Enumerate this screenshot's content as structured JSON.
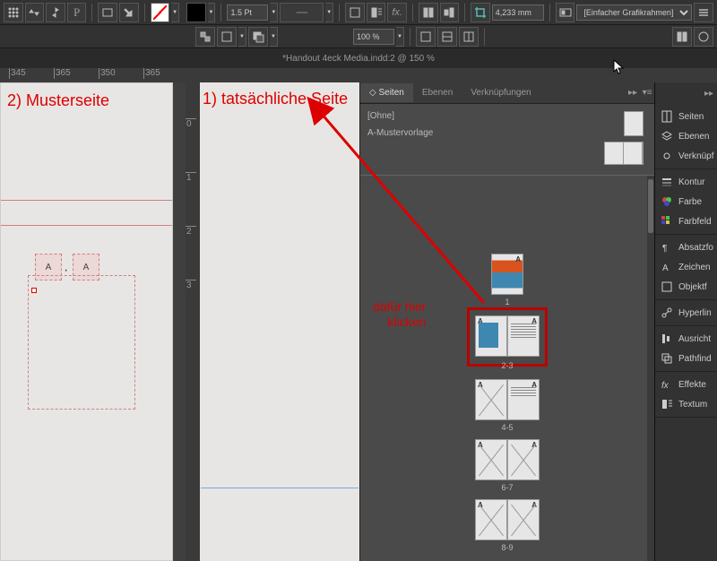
{
  "toolbar1": {
    "stroke_weight": "1.5 Pt",
    "width_value": "4,233 mm",
    "frame_type": "[Einfacher Grafikrahmen]"
  },
  "toolbar2": {
    "zoom": "100 %"
  },
  "document_title": "*Handout 4eck Media.indd:2 @ 150 %",
  "hruler_ticks": [
    "345",
    "365",
    "350",
    "365"
  ],
  "vruler_ticks": [
    "0",
    "1",
    "2",
    "3"
  ],
  "pages_panel": {
    "tabs": [
      "Seiten",
      "Ebenen",
      "Verknüpfungen"
    ],
    "master_none": "[Ohne]",
    "master_a": "A-Mustervorlage",
    "page_labels": [
      "1",
      "2-3",
      "4-5",
      "6-7",
      "8-9"
    ]
  },
  "dock": {
    "items": [
      "Seiten",
      "Ebenen",
      "Verknüpf",
      "Kontur",
      "Farbe",
      "Farbfeld",
      "Absatzfo",
      "Zeichen",
      "Objektf",
      "Hyperlin",
      "Ausricht",
      "Pathfind",
      "Effekte",
      "Textum"
    ]
  },
  "annotations": {
    "left": "2) Musterseite",
    "right": "1) tatsächliche Seite",
    "click": "dafür hier\nklicken"
  },
  "glyph_A": "A"
}
